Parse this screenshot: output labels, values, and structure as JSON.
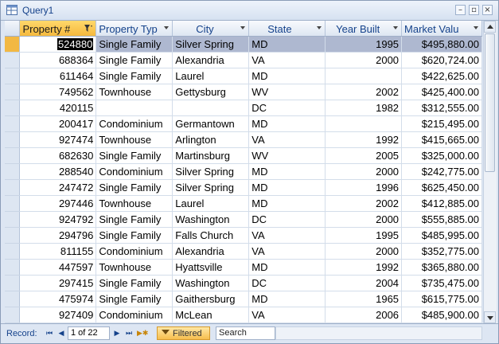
{
  "window": {
    "title": "Query1"
  },
  "columns": [
    {
      "label": "Property #"
    },
    {
      "label": "Property Typ"
    },
    {
      "label": "City"
    },
    {
      "label": "State"
    },
    {
      "label": "Year Built"
    },
    {
      "label": "Market Valu"
    }
  ],
  "rows": [
    {
      "prop": "524880",
      "type": "Single Family",
      "city": "Silver Spring",
      "state": "MD",
      "year": "1995",
      "value": "$495,880.00"
    },
    {
      "prop": "688364",
      "type": "Single Family",
      "city": "Alexandria",
      "state": "VA",
      "year": "2000",
      "value": "$620,724.00"
    },
    {
      "prop": "611464",
      "type": "Single Family",
      "city": "Laurel",
      "state": "MD",
      "year": "",
      "value": "$422,625.00"
    },
    {
      "prop": "749562",
      "type": "Townhouse",
      "city": "Gettysburg",
      "state": "WV",
      "year": "2002",
      "value": "$425,400.00"
    },
    {
      "prop": "420115",
      "type": "",
      "city": "",
      "state": "DC",
      "year": "1982",
      "value": "$312,555.00"
    },
    {
      "prop": "200417",
      "type": "Condominium",
      "city": "Germantown",
      "state": "MD",
      "year": "",
      "value": "$215,495.00"
    },
    {
      "prop": "927474",
      "type": "Townhouse",
      "city": "Arlington",
      "state": "VA",
      "year": "1992",
      "value": "$415,665.00"
    },
    {
      "prop": "682630",
      "type": "Single Family",
      "city": "Martinsburg",
      "state": "WV",
      "year": "2005",
      "value": "$325,000.00"
    },
    {
      "prop": "288540",
      "type": "Condominium",
      "city": "Silver Spring",
      "state": "MD",
      "year": "2000",
      "value": "$242,775.00"
    },
    {
      "prop": "247472",
      "type": "Single Family",
      "city": "Silver Spring",
      "state": "MD",
      "year": "1996",
      "value": "$625,450.00"
    },
    {
      "prop": "297446",
      "type": "Townhouse",
      "city": "Laurel",
      "state": "MD",
      "year": "2002",
      "value": "$412,885.00"
    },
    {
      "prop": "924792",
      "type": "Single Family",
      "city": "Washington",
      "state": "DC",
      "year": "2000",
      "value": "$555,885.00"
    },
    {
      "prop": "294796",
      "type": "Single Family",
      "city": "Falls Church",
      "state": "VA",
      "year": "1995",
      "value": "$485,995.00"
    },
    {
      "prop": "811155",
      "type": "Condominium",
      "city": "Alexandria",
      "state": "VA",
      "year": "2000",
      "value": "$352,775.00"
    },
    {
      "prop": "447597",
      "type": "Townhouse",
      "city": "Hyattsville",
      "state": "MD",
      "year": "1992",
      "value": "$365,880.00"
    },
    {
      "prop": "297415",
      "type": "Single Family",
      "city": "Washington",
      "state": "DC",
      "year": "2004",
      "value": "$735,475.00"
    },
    {
      "prop": "475974",
      "type": "Single Family",
      "city": "Gaithersburg",
      "state": "MD",
      "year": "1965",
      "value": "$615,775.00"
    },
    {
      "prop": "927409",
      "type": "Condominium",
      "city": "McLean",
      "state": "VA",
      "year": "2006",
      "value": "$485,900.00"
    }
  ],
  "navigation": {
    "record_label": "Record:",
    "record_position": "1 of 22",
    "filter_label": "Filtered",
    "search_text": "Search"
  },
  "colors": {
    "header_selected": "#f5b93d",
    "current_row": "#aeb8d0",
    "title_text": "#15428b"
  }
}
